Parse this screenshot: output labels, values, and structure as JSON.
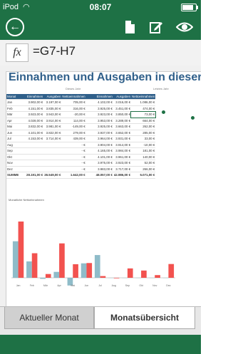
{
  "status": {
    "carrier": "iPod",
    "time": "08:07"
  },
  "formula_bar": {
    "fx_label": "fx",
    "value": "=G7-H7"
  },
  "sheet": {
    "title": "Einnahmen und Ausgaben in dieser",
    "section_left": "Dieses Jahr",
    "section_right": "Letztes Jahr",
    "headers": [
      "Monat",
      "Einnahmen",
      "Ausgaben",
      "Nettoeinnahmen",
      "Einnahmen",
      "Ausgaben",
      "Nettoeinnahmen"
    ],
    "rows": [
      [
        "Jan",
        "3.902,00 €",
        "3.197,00 €",
        "705,00 €",
        "4.102,00 €",
        "3.016,00 €",
        "1.086,00 €"
      ],
      [
        "Feb",
        "4.151,00 €",
        "3.835,00 €",
        "316,00 €",
        "3.925,00 €",
        "3.451,00 €",
        "474,00 €"
      ],
      [
        "Mär",
        "3.923,00 €",
        "3.943,00 €",
        "-20,00 €",
        "3.923,00 €",
        "3.850,00 €",
        "73,00 €"
      ],
      [
        "Apr",
        "4.028,00 €",
        "3.914,00 €",
        "114,00 €",
        "3.953,00 €",
        "3.289,00 €",
        "664,00 €"
      ],
      [
        "Mai",
        "3.832,00 €",
        "3.981,00 €",
        "-149,00 €",
        "3.925,00 €",
        "3.663,00 €",
        "262,00 €"
      ],
      [
        "Jun",
        "4.101,00 €",
        "3.822,00 €",
        "279,00 €",
        "3.937,00 €",
        "3.652,00 €",
        "285,00 €"
      ],
      [
        "Jul",
        "4.153,00 €",
        "3.714,00 €",
        "439,00 €",
        "3.964,00 €",
        "3.931,00 €",
        "33,00 €"
      ],
      [
        "Aug",
        "",
        "",
        "- €",
        "3.904,00 €",
        "3.914,00 €",
        "-10,00 €"
      ],
      [
        "Sep",
        "",
        "",
        "- €",
        "4.165,00 €",
        "3.984,00 €",
        "181,00 €"
      ],
      [
        "Okt",
        "",
        "",
        "- €",
        "4.101,00 €",
        "3.961,00 €",
        "140,00 €"
      ],
      [
        "Nov",
        "",
        "",
        "- €",
        "3.975,00 €",
        "3.923,00 €",
        "52,00 €"
      ],
      [
        "Dez",
        "",
        "",
        "- €",
        "3.983,00 €",
        "3.717,00 €",
        "266,00 €"
      ]
    ],
    "sum_row": [
      "SUMME",
      "28.191,00 €",
      "26.549,00 €",
      "1.642,00 €",
      "48.057,00 €",
      "42.986,00 €",
      "5.071,00 €"
    ],
    "chart_title": "Monatliche Nettoeinnahmen"
  },
  "chart_data": {
    "type": "bar",
    "categories": [
      "Jan",
      "Feb",
      "Mär",
      "Apr",
      "Mai",
      "Jun",
      "Jul",
      "Aug",
      "Sep",
      "Okt",
      "Nov",
      "Dez"
    ],
    "series": [
      {
        "values": [
          705,
          316,
          -20,
          114,
          -149,
          279,
          439,
          0,
          0,
          0,
          0,
          0
        ]
      },
      {
        "values": [
          1086,
          474,
          73,
          664,
          262,
          285,
          33,
          -10,
          181,
          140,
          52,
          266
        ]
      }
    ],
    "colors": [
      "#8fbcc9",
      "#f2524f"
    ]
  },
  "tabs": {
    "tab1": "Aktueller Monat",
    "tab2": "Monatsübersicht"
  },
  "colors": {
    "brand": "#1e7145",
    "header_blue": "#2f5f8a"
  }
}
